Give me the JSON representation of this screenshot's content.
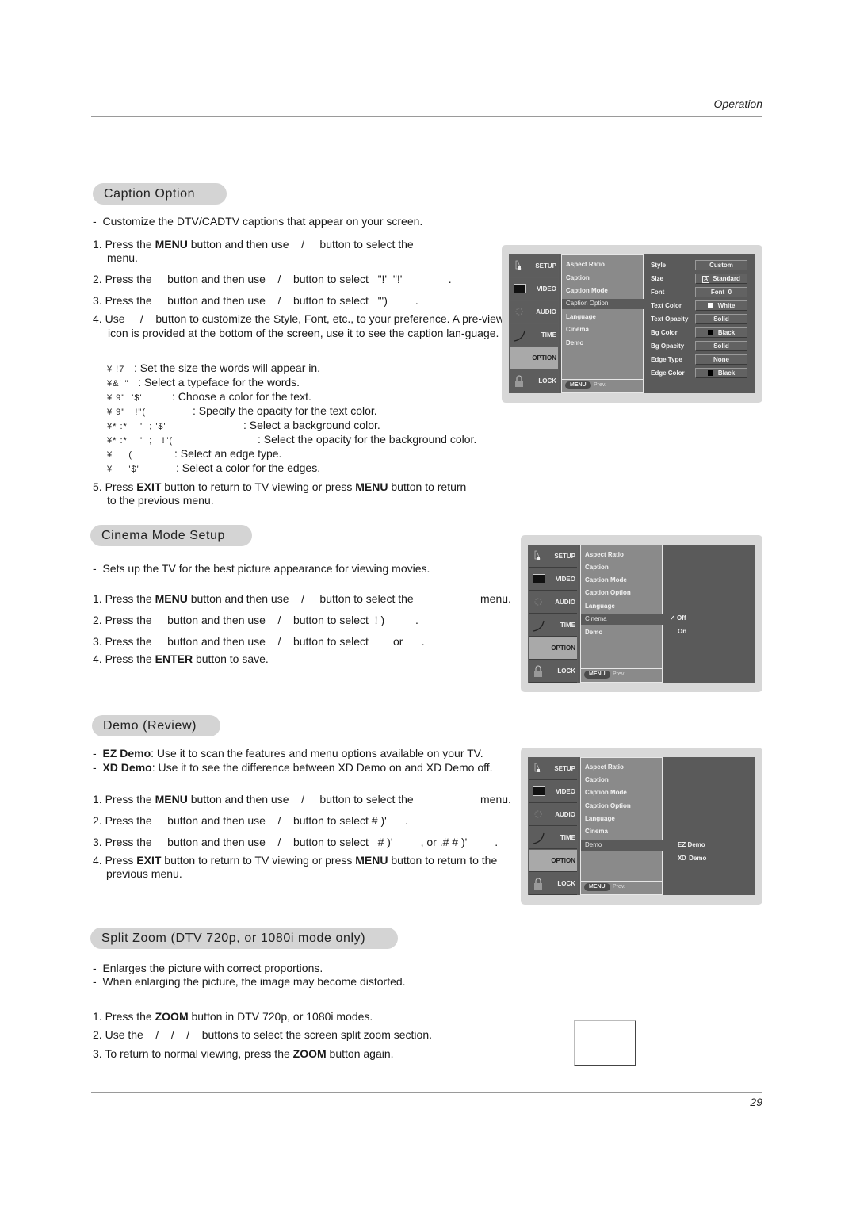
{
  "header": {
    "section": "Operation"
  },
  "footer": {
    "page_number": "29"
  },
  "caption_option": {
    "title": "Caption Option",
    "intro": "Customize the DTV/CADTV captions that appear on your screen.",
    "steps": [
      {
        "num": "1.",
        "pre": "Press the ",
        "bold": "MENU",
        "post": " button and then use    /     button to select the",
        "cont": "menu."
      },
      {
        "num": "2.",
        "text": "Press the     button and then use    /    button to select   \"!'  \"!'               ."
      },
      {
        "num": "3.",
        "text": "Press the     button and then use    /    button to select   \"')         ."
      },
      {
        "num": "4.",
        "text": "Use     /    button to customize the Style, Font, etc., to your preference. A pre-view icon is provided at the bottom of the screen, use it to see the caption lan-guage."
      }
    ],
    "options": [
      {
        "code": "¥ !7",
        "desc": ": Set the size the words will appear in."
      },
      {
        "code": "¥&' \"",
        "desc": ": Select a typeface for the words."
      },
      {
        "code": "¥ 9\"  '$'",
        "desc": ": Choose a color for the text."
      },
      {
        "code": "¥ 9\"   !\"(",
        "desc": ": Specify the opacity for the text color."
      },
      {
        "code": "¥* :*    '  ; '$'",
        "desc": ": Select a background color."
      },
      {
        "code": "¥* :*    '  ;   !\"(",
        "desc": ": Select the opacity for the background color."
      },
      {
        "code": "¥     (",
        "desc": ": Select an edge type."
      },
      {
        "code": "¥     '$'",
        "desc": ": Select a color for the edges."
      }
    ],
    "step5": {
      "num": "5.",
      "a": "Press ",
      "b1": "EXIT",
      "c": " button to return to TV viewing or press ",
      "b2": "MENU",
      "d": " button to return",
      "cont": "to the previous menu."
    }
  },
  "cinema_mode": {
    "title": "Cinema Mode Setup",
    "intro": "Sets up the TV for the best picture appearance for viewing movies.",
    "steps": [
      {
        "num": "1.",
        "pre": "Press the ",
        "bold": "MENU",
        "post": " button and then use    /     button to select the",
        "tail": "menu."
      },
      {
        "num": "2.",
        "text": "Press the     button and then use    /    button to select  ! )          ."
      },
      {
        "num": "3.",
        "text": "Press the     button and then use    /    button to select        or      ."
      },
      {
        "num": "4.",
        "pre": "Press the ",
        "bold": "ENTER",
        "post": " button to save."
      }
    ]
  },
  "demo": {
    "title": "Demo (Review)",
    "bullets": [
      {
        "bold": "EZ Demo",
        "text": ": Use it to scan the features and menu options available on your TV."
      },
      {
        "bold": "XD Demo",
        "text": ": Use it to see the difference between XD Demo on and XD Demo off."
      }
    ],
    "steps": [
      {
        "num": "1.",
        "pre": "Press the ",
        "bold": "MENU",
        "post": " button and then use    /     button to select the",
        "tail": "menu."
      },
      {
        "num": "2.",
        "text": "Press the     button and then use    /    button to select # )'      ."
      },
      {
        "num": "3.",
        "text": "Press the     button and then use    /    button to select   # )'         , or .# # )'         ."
      },
      {
        "num": "4.",
        "a": "Press ",
        "b1": "EXIT",
        "c": " button to return to TV viewing or press ",
        "b2": "MENU",
        "d": " button to return to the",
        "cont": "previous menu."
      }
    ]
  },
  "split_zoom": {
    "title": "Split Zoom (DTV 720p, or 1080i mode only)",
    "bullets": [
      "Enlarges the picture with correct proportions.",
      "When enlarging the picture, the image may become distorted."
    ],
    "steps": [
      {
        "num": "1.",
        "pre": "Press the ",
        "bold": "ZOOM",
        "post": " button in DTV 720p, or 1080i modes."
      },
      {
        "num": "2.",
        "text": "Use the    /    /    /    buttons to select the screen split zoom section."
      },
      {
        "num": "3.",
        "pre": "To return to normal viewing, press the ",
        "bold": "ZOOM",
        "post": " button again."
      }
    ]
  },
  "osd": {
    "side_menu": [
      "SETUP",
      "VIDEO",
      "AUDIO",
      "TIME",
      "OPTION",
      "LOCK"
    ],
    "active_side": "OPTION",
    "option_items": [
      "Aspect Ratio",
      "Caption",
      "Caption Mode",
      "Caption Option",
      "Language",
      "Cinema",
      "Demo"
    ],
    "menu_button": "MENU",
    "prev_label": "Prev.",
    "caption_panel": {
      "selected": "Caption Option",
      "settings": [
        {
          "label": "Style",
          "value": "Custom"
        },
        {
          "label": "Size",
          "value": "Standard",
          "prefix": "A"
        },
        {
          "label": "Font",
          "value": "Font  0"
        },
        {
          "label": "Text Color",
          "value": "White",
          "swatch": "#ffffff"
        },
        {
          "label": "Text Opacity",
          "value": "Solid"
        },
        {
          "label": "Bg Color",
          "value": "Black",
          "swatch": "#000000"
        },
        {
          "label": "Bg Opacity",
          "value": "Solid"
        },
        {
          "label": "Edge Type",
          "value": "None"
        },
        {
          "label": "Edge Color",
          "value": "Black",
          "swatch": "#000000"
        }
      ]
    },
    "cinema_panel": {
      "selected": "Cinema",
      "values": [
        {
          "label": "Off",
          "checked": true
        },
        {
          "label": "On",
          "checked": false
        }
      ],
      "check_mark": "✓"
    },
    "demo_panel": {
      "selected": "Demo",
      "values": [
        "EZ Demo",
        "Demo"
      ],
      "xd_logo": "XD"
    }
  }
}
